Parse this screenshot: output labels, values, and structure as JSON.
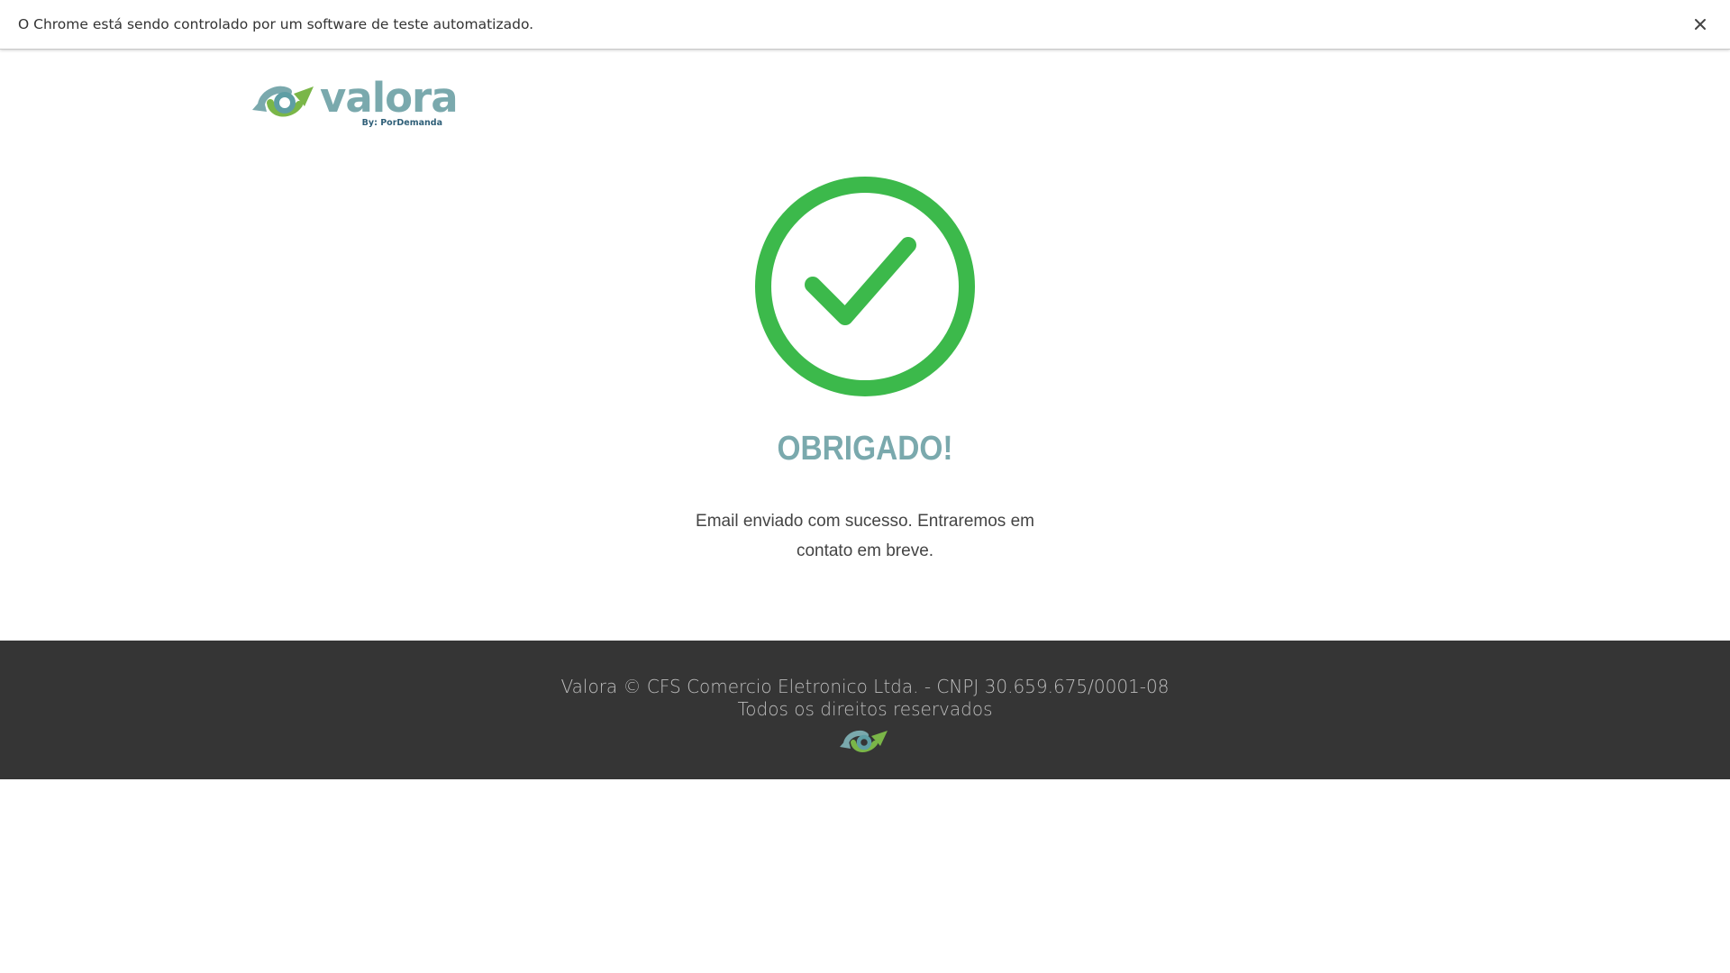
{
  "infobar": {
    "message": "O Chrome está sendo controlado por um software de teste automatizado.",
    "close_icon": "close-icon"
  },
  "header": {
    "logo_word": "valora",
    "logo_sub": "By: PorDemanda"
  },
  "main": {
    "status_icon": "check-circle-icon",
    "title": "OBRIGADO!",
    "message": "Email enviado com sucesso. Entraremos em contato em breve."
  },
  "footer": {
    "copyright": "Valora © CFS Comercio Eletronico Ltda. - CNPJ 30.659.675/0001-08",
    "rights": "Todos os direitos reservados",
    "logo_icon": "valora-logo-icon"
  },
  "colors": {
    "brand_teal": "#7aa9ad",
    "brand_green": "#7ab648",
    "success_green": "#3cb94b",
    "footer_bg": "#353535"
  }
}
